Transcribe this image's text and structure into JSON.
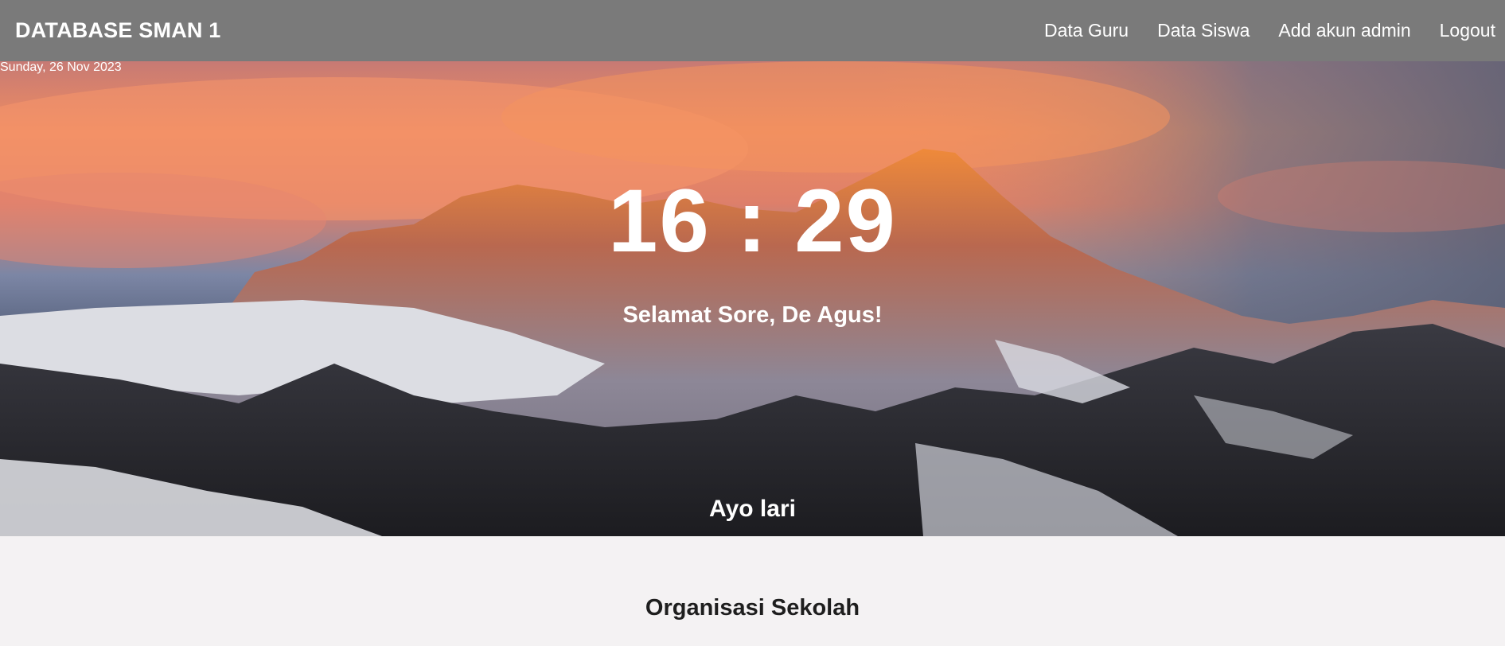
{
  "navbar": {
    "brand": "DATABASE SMAN 1",
    "links": [
      "Data Guru",
      "Data Siswa",
      "Add akun admin",
      "Logout"
    ],
    "background_color": "#7a7a7a"
  },
  "hero": {
    "date": "Sunday, 26 Nov 2023",
    "clock": "16 : 29",
    "greeting": "Selamat Sore, De Agus!",
    "motto": "Ayo lari",
    "background_image": "snowy mountain at sunset"
  },
  "section": {
    "title": "Organisasi Sekolah"
  }
}
